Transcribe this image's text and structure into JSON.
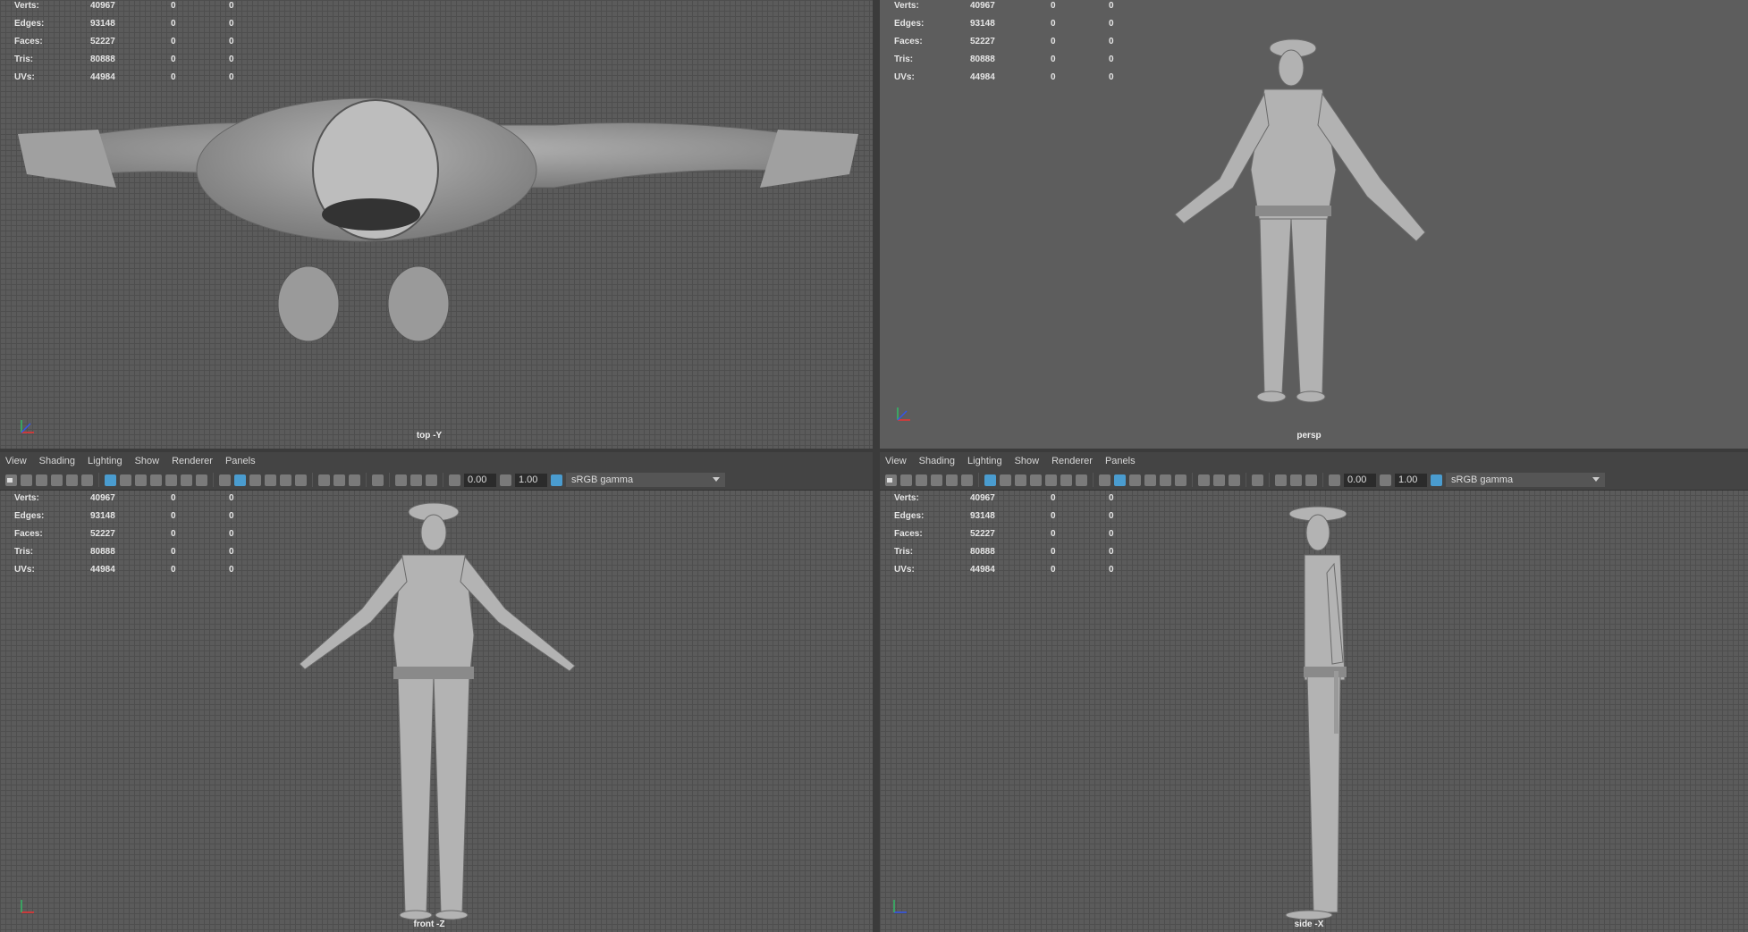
{
  "stats": {
    "labels": [
      "Verts:",
      "Edges:",
      "Faces:",
      "Tris:",
      "UVs:"
    ],
    "values": [
      "40967",
      "93148",
      "52227",
      "80888",
      "44984"
    ],
    "zero": "0"
  },
  "viewports": {
    "top": {
      "label": "top -Y"
    },
    "persp": {
      "label": "persp"
    },
    "front": {
      "label": "front -Z"
    },
    "side": {
      "label": "side -X"
    }
  },
  "panel_menu": {
    "view": "View",
    "shading": "Shading",
    "lighting": "Lighting",
    "show": "Show",
    "renderer": "Renderer",
    "panels": "Panels"
  },
  "toolbar": {
    "exposure": "0.00",
    "gamma": "1.00",
    "color_space": "sRGB gamma"
  }
}
